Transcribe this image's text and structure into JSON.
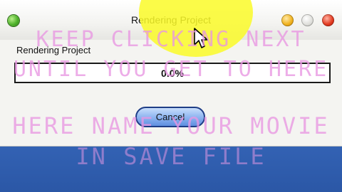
{
  "window": {
    "title": "Rendering Project"
  },
  "dialog": {
    "label": "Rendering Project",
    "progress": {
      "text": "0.0%",
      "fraction": 0.0
    },
    "cancel_label": "Cancel"
  },
  "overlay_text": [
    "KEEP CLICKING NEXT",
    "UNTIL YOU GET TO HERE",
    "HERE NAME YOUR MOVIE",
    "IN SAVE FILE"
  ],
  "colors": {
    "highlight": "#f4f43c",
    "overlay_text": "#e896e1",
    "desktop": "#3a6cc0"
  },
  "icons": [
    "app-icon",
    "minimize-icon",
    "maximize-icon",
    "close-icon",
    "mouse-cursor-icon"
  ]
}
